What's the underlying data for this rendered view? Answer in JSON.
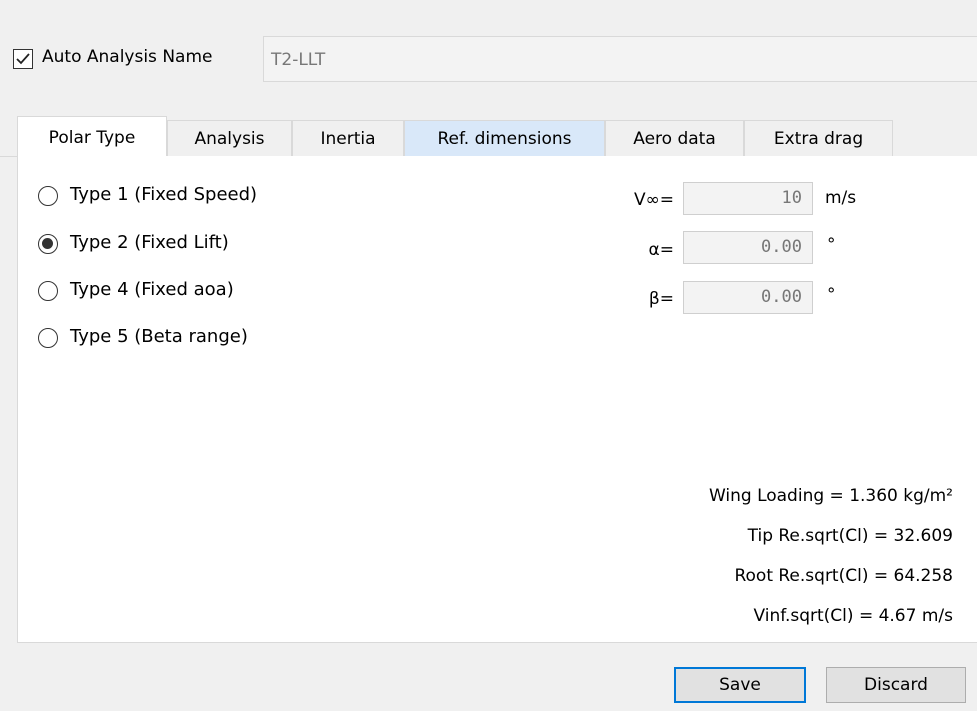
{
  "header": {
    "auto_name_checked": true,
    "auto_name_label": "Auto Analysis Name",
    "analysis_name_value": "T2-LLT"
  },
  "tabs": [
    {
      "label": "Polar Type",
      "active": true
    },
    {
      "label": "Analysis"
    },
    {
      "label": "Inertia"
    },
    {
      "label": "Ref. dimensions"
    },
    {
      "label": "Aero data"
    },
    {
      "label": "Extra drag"
    }
  ],
  "polar_types": [
    {
      "label": "Type 1 (Fixed Speed)",
      "checked": false
    },
    {
      "label": "Type 2 (Fixed Lift)",
      "checked": true
    },
    {
      "label": "Type 4 (Fixed aoa)",
      "checked": false
    },
    {
      "label": "Type 5 (Beta range)",
      "checked": false
    }
  ],
  "params": {
    "vinf": {
      "label": "V∞=",
      "value": "10",
      "unit": "m/s"
    },
    "alpha": {
      "label": "α=",
      "value": "0.00",
      "unit": "°"
    },
    "beta": {
      "label": "β=",
      "value": "0.00",
      "unit": "°"
    }
  },
  "stats": {
    "wing_loading": "Wing Loading =  1.360 kg/m²",
    "tip_re": "Tip Re.sqrt(Cl) =  32.609",
    "root_re": "Root Re.sqrt(Cl) =  64.258",
    "vinf_sqrt": "Vinf.sqrt(Cl) = 4.67 m/s"
  },
  "buttons": {
    "save": "Save",
    "discard": "Discard"
  },
  "colors": {
    "default_button_border": "#0078d7",
    "hover_tab": "#d9e8f9"
  }
}
